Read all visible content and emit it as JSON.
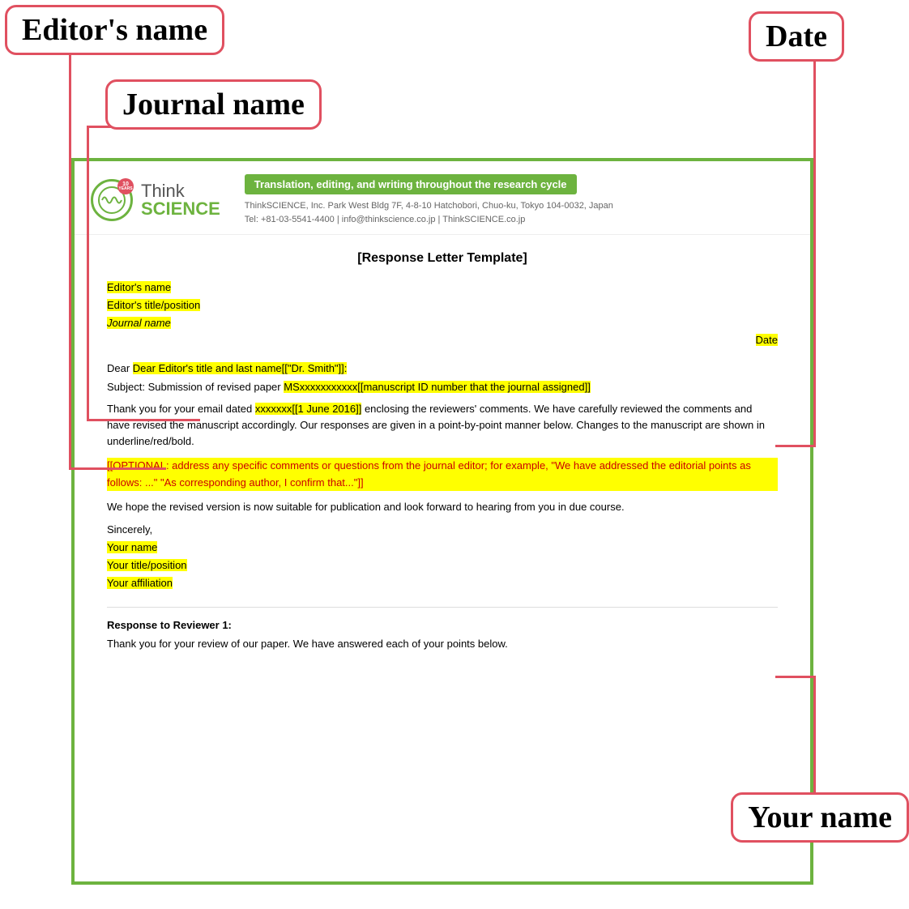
{
  "annotations": {
    "editors_name_label": "Editor's name",
    "date_label": "Date",
    "journal_name_label": "Journal name",
    "your_name_label": "Your name"
  },
  "header": {
    "years": "10",
    "years_sub": "YEARS",
    "think": "Think",
    "science": "SCIENCE",
    "tagline": "Translation, editing, and writing throughout the research cycle",
    "contact_line1": "ThinkSCIENCE, Inc.  Park West Bldg 7F, 4-8-10 Hatchobori, Chuo-ku, Tokyo 104-0032, Japan",
    "contact_line2": "Tel: +81-03-5541-4400 | info@thinkscience.co.jp | ThinkSCIENCE.co.jp"
  },
  "letter": {
    "title": "[Response Letter Template]",
    "editors_name": "Editor's name",
    "editors_title": "Editor's title/position",
    "journal_name": "Journal name",
    "date_field": "Date",
    "dear_line": "Dear Editor's title and last name[[\"Dr. Smith\"]]:",
    "subject_prefix": "Subject:  Submission of revised paper  ",
    "subject_highlight": "MSxxxxxxxxxxx[[manuscript ID number that the journal assigned]]",
    "body1": "Thank you for your email dated ",
    "body1_highlight": "xxxxxxx[[1 June 2016]]",
    "body1_cont": " enclosing the reviewers' comments. We have carefully reviewed the comments and have revised the manuscript accordingly. Our responses are given in a point-by-point manner below. Changes to the manuscript are shown in underline/red/bold.",
    "optional": "[[OPTIONAL: address any specific comments or questions from the journal editor; for example, \"We have addressed the editorial points as follows: ...\" \"As corresponding author, I confirm that...\"]]",
    "hope_text": "We hope the revised version is now suitable for publication and look forward to hearing from you in due course.",
    "sincerely": "Sincerely,",
    "your_name": "Your name",
    "your_title": "Your title/position",
    "your_affiliation": "Your affiliation",
    "reviewer_title": "Response to Reviewer 1:",
    "reviewer_text": "Thank you for your review of our paper. We have answered each of your points below."
  }
}
